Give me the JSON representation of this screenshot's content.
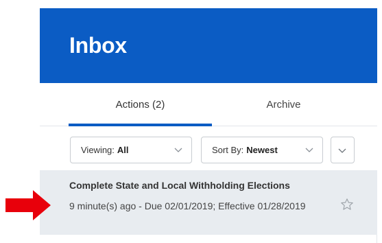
{
  "header": {
    "title": "Inbox"
  },
  "tabs": [
    {
      "label": "Actions (2)",
      "active": true
    },
    {
      "label": "Archive",
      "active": false
    }
  ],
  "filters": {
    "viewing": {
      "label": "Viewing:",
      "value": "All"
    },
    "sort": {
      "label": "Sort By:",
      "value": "Newest"
    }
  },
  "items": [
    {
      "title": "Complete State and Local Withholding Elections",
      "meta": "9 minute(s) ago - Due 02/01/2019; Effective 01/28/2019"
    }
  ],
  "icons": {
    "star": "star-outline-icon",
    "chevron": "chevron-down-icon",
    "pointer": "red-arrow-icon"
  },
  "colors": {
    "header_bg": "#0b5cc4",
    "tab_underline": "#0b5cc4",
    "item_bg": "#e8ecf0",
    "arrow": "#e8000b"
  }
}
